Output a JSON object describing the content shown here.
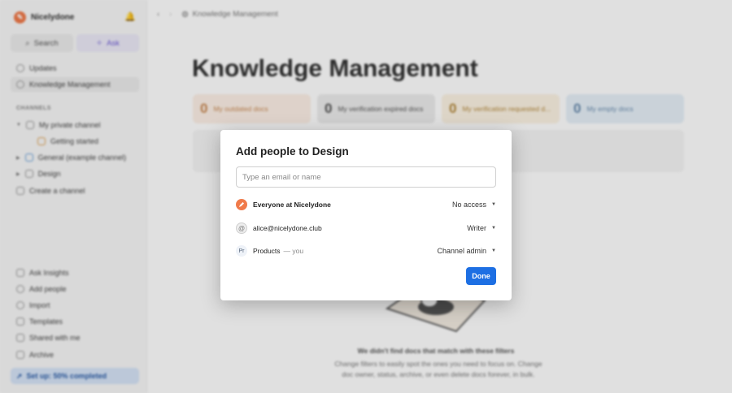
{
  "sidebar": {
    "brand": "Nicelydone",
    "search_label": "Search",
    "ask_label": "Ask",
    "nav_top": [
      {
        "label": "Updates"
      },
      {
        "label": "Knowledge Management"
      }
    ],
    "channels_heading": "CHANNELS",
    "channels": [
      {
        "label": "My private channel"
      },
      {
        "label": "Getting started"
      },
      {
        "label": "General (example channel)"
      },
      {
        "label": "Design"
      },
      {
        "label": "Create a channel"
      }
    ],
    "nav_bottom": [
      {
        "label": "Ask Insights"
      },
      {
        "label": "Add people"
      },
      {
        "label": "Import"
      },
      {
        "label": "Templates"
      },
      {
        "label": "Shared with me"
      },
      {
        "label": "Archive"
      }
    ],
    "setup_label": "Set up: 50% completed"
  },
  "header": {
    "breadcrumb": "Knowledge Management"
  },
  "main": {
    "title": "Knowledge Management",
    "cards": [
      {
        "count": "0",
        "label": "My outdated docs"
      },
      {
        "count": "0",
        "label": "My verification expired docs"
      },
      {
        "count": "0",
        "label": "My verification requested d..."
      },
      {
        "count": "0",
        "label": "My empty docs"
      }
    ],
    "empty_title": "We didn't find docs that match with these filters",
    "empty_desc": "Change filters to easily spot the ones you need to focus on. Change doc owner, status, archive, or even delete docs forever, in bulk."
  },
  "modal": {
    "title": "Add people to Design",
    "input_placeholder": "Type an email or name",
    "people": [
      {
        "avatar": "",
        "name": "Everyone at Nicelydone",
        "suffix": "",
        "permission": "No access"
      },
      {
        "avatar": "@",
        "name": "alice@nicelydone.club",
        "suffix": "",
        "permission": "Writer"
      },
      {
        "avatar": "Pr",
        "name": "Products",
        "suffix": "— you",
        "permission": "Channel admin"
      }
    ],
    "done_label": "Done"
  },
  "colors": {
    "primary": "#1d6fe3",
    "brand": "#f07a4a",
    "ask_accent": "#6c5ad6"
  }
}
